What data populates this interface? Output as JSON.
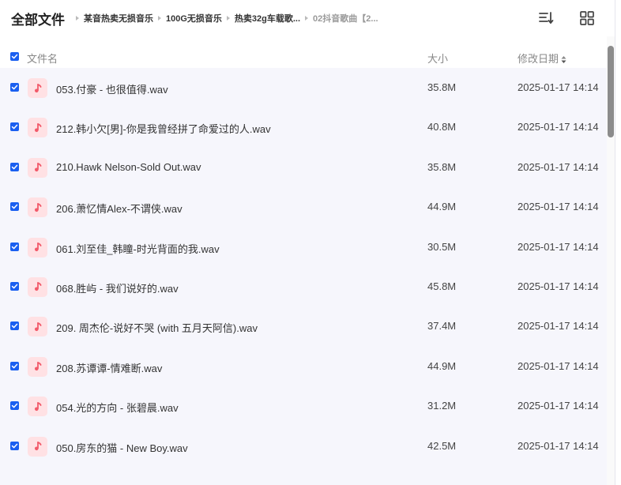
{
  "breadcrumb": {
    "root": "全部文件",
    "items": [
      "某音热卖无损音乐",
      "100G无损音乐",
      "热卖32g车载歌...",
      "02抖音歌曲【2..."
    ]
  },
  "toolbar": {
    "sort_icon": "sort-list-icon",
    "grid_icon": "grid-view-icon"
  },
  "columns": {
    "name": "文件名",
    "size": "大小",
    "date": "修改日期"
  },
  "colors": {
    "checkbox": "#1a5ff0",
    "file_icon_bg": "#ffe1e4",
    "file_icon": "#f25a6a",
    "list_bg": "#f6f6fc"
  },
  "files": [
    {
      "name": "053.付豪 - 也很值得.wav",
      "size": "35.8M",
      "date": "2025-01-17 14:14"
    },
    {
      "name": "212.韩小欠[男]-你是我曾经拼了命爱过的人.wav",
      "size": "40.8M",
      "date": "2025-01-17 14:14"
    },
    {
      "name": "210.Hawk Nelson-Sold Out.wav",
      "size": "35.8M",
      "date": "2025-01-17 14:14"
    },
    {
      "name": "206.萧忆情Alex-不谓侠.wav",
      "size": "44.9M",
      "date": "2025-01-17 14:14"
    },
    {
      "name": "061.刘至佳_韩瞳-时光背面的我.wav",
      "size": "30.5M",
      "date": "2025-01-17 14:14"
    },
    {
      "name": "068.胜屿 - 我们说好的.wav",
      "size": "45.8M",
      "date": "2025-01-17 14:14"
    },
    {
      "name": "209. 周杰伦-说好不哭 (with 五月天阿信).wav",
      "size": "37.4M",
      "date": "2025-01-17 14:14"
    },
    {
      "name": "208.苏谭谭-情难断.wav",
      "size": "44.9M",
      "date": "2025-01-17 14:14"
    },
    {
      "name": "054.光的方向 - 张碧晨.wav",
      "size": "31.2M",
      "date": "2025-01-17 14:14"
    },
    {
      "name": "050.房东的猫 - New Boy.wav",
      "size": "42.5M",
      "date": "2025-01-17 14:14"
    }
  ]
}
